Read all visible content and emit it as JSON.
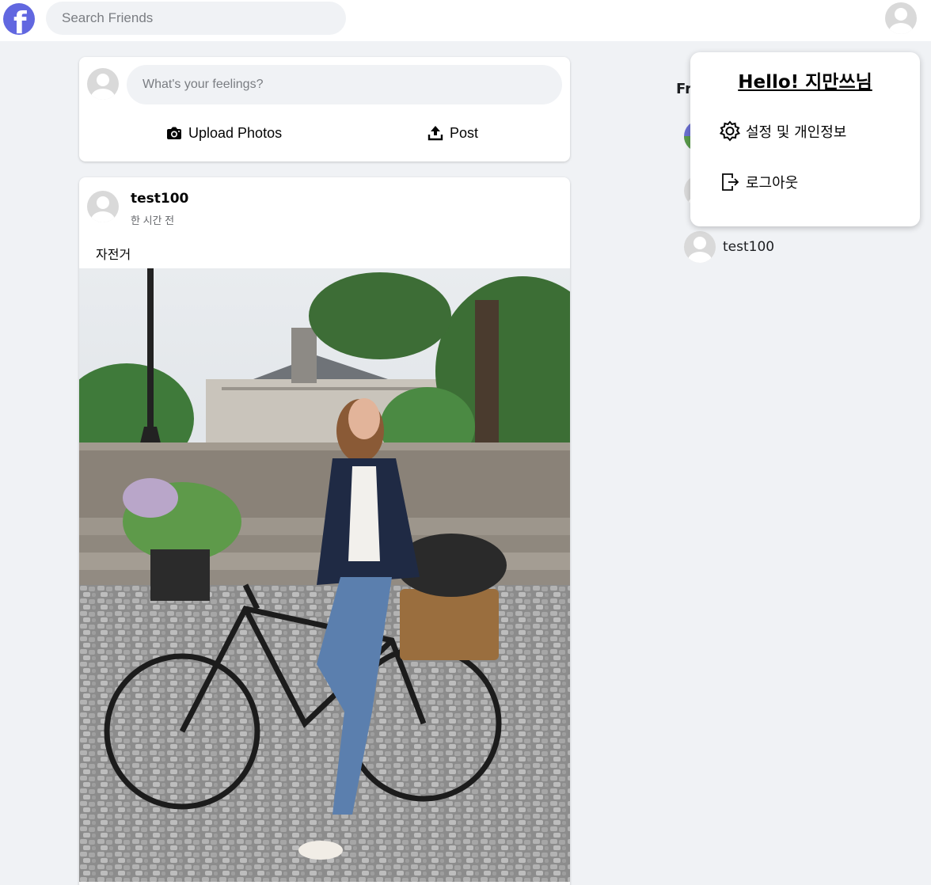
{
  "header": {
    "logo_letter": "f",
    "search_placeholder": "Search Friends"
  },
  "composer": {
    "placeholder": "What's your feelings?",
    "upload_label": "Upload Photos",
    "post_label": "Post"
  },
  "post": {
    "author": "test100",
    "time": "한 시간 전",
    "text": "자전거",
    "image_description": "photo-woman-on-bicycle"
  },
  "friends": {
    "title_visible": "Fr",
    "items": [
      {
        "name": "",
        "avatar": "photo"
      },
      {
        "name": "",
        "avatar": "default"
      },
      {
        "name": "test100",
        "avatar": "default"
      }
    ]
  },
  "profile_menu": {
    "greeting": "Hello! 지만쓰님",
    "settings_label": "설정 및 개인정보",
    "logout_label": "로그아웃"
  },
  "colors": {
    "brand": "#6167e0",
    "background": "#f0f2f5",
    "card": "#ffffff"
  }
}
